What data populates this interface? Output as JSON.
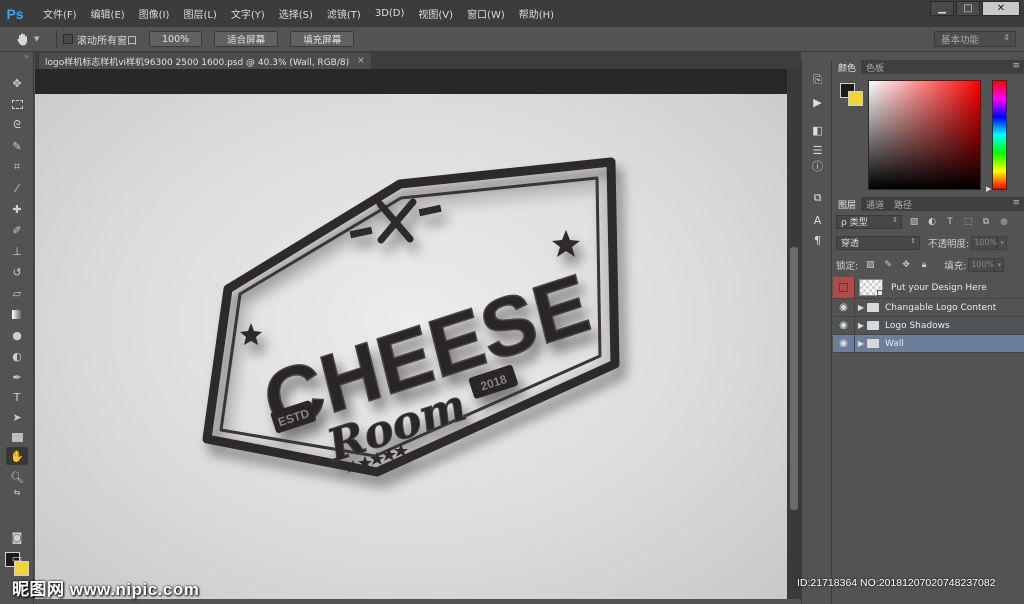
{
  "app": {
    "logo": "Ps",
    "menu": [
      "文件(F)",
      "编辑(E)",
      "图像(I)",
      "图层(L)",
      "文字(Y)",
      "选择(S)",
      "滤镜(T)",
      "3D(D)",
      "视图(V)",
      "窗口(W)",
      "帮助(H)"
    ],
    "window_controls": {
      "minimize": "▁",
      "restore": "□",
      "close": "✕"
    }
  },
  "options": {
    "scroll_all_label": "滚动所有窗口",
    "btn_100": "100%",
    "btn_fit": "适合屏幕",
    "btn_fill": "填充屏幕",
    "workspace": "基本功能"
  },
  "document": {
    "tab_title": "logo样机标志样机vi样机96300 2500 1600.psd @ 40.3% (Wall, RGB/8)",
    "tab_close": "×"
  },
  "artwork": {
    "line1": "CHEESE",
    "line2": "Room",
    "left_badge": "ESTD",
    "right_badge": "2018"
  },
  "colors": {
    "foreground": "#1a1a1a",
    "background": "#f2d53b",
    "selected_layer": "#6b7f9a"
  },
  "color_panel": {
    "tabs": [
      "颜色",
      "色板"
    ]
  },
  "layers_panel": {
    "tabs": [
      "图层",
      "通道",
      "路径"
    ],
    "filter_label": "ρ 类型",
    "blend_mode": "穿透",
    "opacity_label": "不透明度:",
    "opacity_value": "100%",
    "lock_label": "锁定:",
    "fill_label": "填充:",
    "fill_value": "100%",
    "layers": [
      {
        "name": "Put your Design Here",
        "type": "smart",
        "visible": false
      },
      {
        "name": "Changable Logo Content",
        "type": "group",
        "visible": true
      },
      {
        "name": "Logo Shadows",
        "type": "group",
        "visible": true
      },
      {
        "name": "Wall",
        "type": "group",
        "visible": true,
        "selected": true
      }
    ]
  },
  "watermark": {
    "left": "昵图网 www.nipic.com",
    "right": "ID:21718364 NO:20181207020748237082"
  }
}
